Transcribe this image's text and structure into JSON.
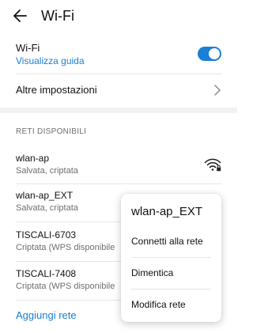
{
  "header": {
    "title": "Wi-Fi",
    "back_icon": "arrow-left-icon"
  },
  "wifi_toggle": {
    "label": "Wi-Fi",
    "guide_link": "Visualizza guida",
    "enabled": true,
    "accent_color": "#1a7fd6"
  },
  "other_settings": {
    "label": "Altre impostazioni",
    "icon": "chevron-right-icon"
  },
  "networks": {
    "section_title": "RETI DISPONIBILI",
    "items": [
      {
        "name": "wlan-ap",
        "status": "Salvata, criptata",
        "icon": "wifi-lock-icon"
      },
      {
        "name": "wlan-ap_EXT",
        "status": "Salvata, criptata"
      },
      {
        "name": "TISCALI-6703",
        "status": "Criptata (WPS disponibile"
      },
      {
        "name": "TISCALI-7408",
        "status": "Criptata (WPS disponibile"
      }
    ],
    "add_label": "Aggiungi rete"
  },
  "context_menu": {
    "title": "wlan-ap_EXT",
    "items": [
      {
        "label": "Connetti alla rete"
      },
      {
        "label": "Dimentica"
      },
      {
        "label": "Modifica rete"
      }
    ]
  }
}
